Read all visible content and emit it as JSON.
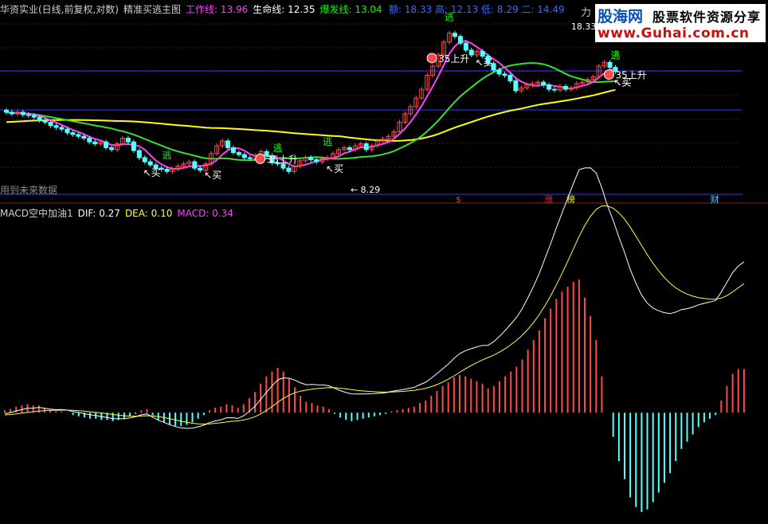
{
  "header": {
    "title": "华资实业(日线,前复权,对数)",
    "indicator": "精准买逃主图",
    "work_line_label": "工作线: ",
    "work_line_value": "13.96",
    "life_line_label": "生命线: ",
    "life_line_value": "12.35",
    "burst_line_label": "爆发线: ",
    "burst_line_value": "13.04",
    "price_summary": "额: 18.33  高: 12.13  低: 8.29  二: 14.49",
    "partial_char": "力"
  },
  "watermark": {
    "brand": "股海网",
    "tagline": "股票软件资源分享",
    "url": "www.Guhai.com.cn"
  },
  "main": {
    "future_note": "用到未来数据"
  },
  "macd": {
    "title": "MACD空中加油1",
    "dif_label": "DIF: ",
    "dif_value": "0.27",
    "dea_label": "DEA: ",
    "dea_value": "0.10",
    "macd_label": "MACD: ",
    "macd_value": "0.34"
  },
  "colors": {
    "background": "#000000",
    "up": "#ff4a4a",
    "down": "#54ffff",
    "work_line": "#ff40ff",
    "burst_line": "#33e033",
    "life_line": "#ffff00",
    "dif": "#ffffff",
    "dea": "#ffff40",
    "escape_label": "#00ff00",
    "buy_label": "#ffffff",
    "guide_line": "#2a3cff"
  },
  "chart_data": [
    {
      "type": "candlestick",
      "scale": "log",
      "price_range": [
        7.9,
        19.6
      ],
      "high_marker": "18.33",
      "low_marker": "8.29",
      "closes": [
        12.1,
        12.0,
        12.1,
        11.95,
        11.9,
        11.8,
        11.6,
        11.5,
        11.3,
        11.2,
        11.1,
        10.9,
        10.8,
        10.7,
        10.6,
        10.4,
        10.3,
        10.4,
        10.1,
        10.0,
        10.3,
        10.6,
        10.4,
        9.95,
        9.6,
        9.4,
        9.25,
        9.1,
        9.05,
        8.95,
        9.05,
        9.2,
        9.3,
        9.4,
        9.1,
        9.0,
        9.3,
        9.8,
        10.2,
        10.45,
        10.1,
        9.85,
        9.75,
        9.6,
        9.55,
        9.7,
        9.9,
        9.7,
        9.35,
        9.3,
        9.1,
        8.95,
        9.2,
        9.45,
        9.6,
        9.5,
        9.4,
        9.55,
        9.6,
        9.8,
        10.0,
        10.1,
        10.0,
        10.2,
        10.3,
        10.0,
        10.2,
        10.45,
        10.55,
        10.7,
        10.95,
        11.5,
        12.0,
        12.45,
        13.0,
        13.6,
        14.6,
        15.3,
        16.2,
        17.3,
        18.1,
        17.8,
        17.2,
        16.6,
        16.2,
        16.5,
        16.1,
        15.5,
        15.0,
        14.7,
        14.6,
        14.2,
        13.5,
        13.7,
        13.9,
        14.0,
        14.1,
        13.9,
        13.6,
        13.55,
        13.8,
        13.6,
        13.7,
        14.0,
        14.1,
        14.3,
        14.5,
        15.3,
        15.6,
        15.2,
        14.9
      ],
      "work_line_end": 13.96,
      "life_line_end": 12.35,
      "burst_line_end": 13.04,
      "labels": [
        {
          "text": "逃",
          "bar": 29,
          "type": "escape"
        },
        {
          "text": "买",
          "bar": 25,
          "type": "buy"
        },
        {
          "text": "买",
          "bar": 36,
          "type": "buy"
        },
        {
          "text": "35上升",
          "bar": 47,
          "type": "rise"
        },
        {
          "text": "逃",
          "bar": 49,
          "type": "escape"
        },
        {
          "text": "逃",
          "bar": 58,
          "type": "escape"
        },
        {
          "text": "买",
          "bar": 58,
          "type": "buy"
        },
        {
          "text": "35上升",
          "bar": 78,
          "type": "rise"
        },
        {
          "text": "逃",
          "bar": 80,
          "type": "escape"
        },
        {
          "text": "买",
          "bar": 85,
          "type": "buy"
        },
        {
          "text": "买",
          "bar": 114,
          "type": "buy"
        },
        {
          "text": "逃",
          "bar": 119,
          "type": "escape"
        },
        {
          "text": "买",
          "bar": 126,
          "type": "buy"
        },
        {
          "text": "35上升",
          "bar": 131,
          "type": "rise"
        },
        {
          "text": "逃",
          "bar": 132,
          "type": "escape"
        }
      ],
      "bottom_tags": [
        {
          "text": "$",
          "bar": 82,
          "color": "#ff2a2a"
        },
        {
          "text": "涨",
          "bar": 98,
          "color": "#ff2a2a"
        },
        {
          "text": "榜",
          "bar": 102,
          "color": "#ffff00"
        },
        {
          "text": "财",
          "bar": 128,
          "color": "#54c8ff"
        }
      ]
    },
    {
      "type": "macd",
      "value_range": [
        -0.9,
        1.6
      ],
      "histogram": [
        0.02,
        0.03,
        0.05,
        0.06,
        0.07,
        0.06,
        0.06,
        0.04,
        0.02,
        0.01,
        0.01,
        0.0,
        -0.02,
        -0.03,
        -0.04,
        -0.05,
        -0.05,
        -0.06,
        -0.06,
        -0.07,
        -0.06,
        -0.05,
        -0.03,
        -0.01,
        0.02,
        0.03,
        -0.02,
        -0.06,
        -0.08,
        -0.1,
        -0.11,
        -0.11,
        -0.1,
        -0.08,
        -0.05,
        -0.02,
        0.02,
        0.04,
        0.05,
        0.07,
        0.06,
        0.04,
        0.07,
        0.12,
        0.17,
        0.24,
        0.3,
        0.34,
        0.37,
        0.34,
        0.28,
        0.21,
        0.14,
        0.09,
        0.08,
        0.06,
        0.05,
        0.03,
        -0.01,
        -0.04,
        -0.06,
        -0.07,
        -0.06,
        -0.05,
        -0.04,
        -0.03,
        -0.02,
        -0.01,
        0.01,
        0.02,
        0.03,
        0.04,
        0.05,
        0.08,
        0.1,
        0.14,
        0.18,
        0.22,
        0.25,
        0.29,
        0.31,
        0.3,
        0.28,
        0.26,
        0.24,
        0.2,
        0.22,
        0.26,
        0.3,
        0.34,
        0.38,
        0.44,
        0.52,
        0.6,
        0.68,
        0.78,
        0.86,
        0.94,
        1.0,
        1.04,
        1.08,
        1.1,
        0.95,
        0.8,
        0.6,
        0.3,
        0.0,
        -0.2,
        -0.4,
        -0.55,
        -0.7,
        -0.78,
        -0.82,
        -0.8,
        -0.74,
        -0.66,
        -0.58,
        -0.5,
        -0.4,
        -0.3,
        -0.24,
        -0.18,
        -0.12,
        -0.08,
        -0.05,
        -0.02,
        0.1,
        0.22,
        0.32,
        0.36,
        0.36
      ],
      "dif_end": 0.27,
      "dea_end": 0.1,
      "macd_end": 0.34
    }
  ]
}
